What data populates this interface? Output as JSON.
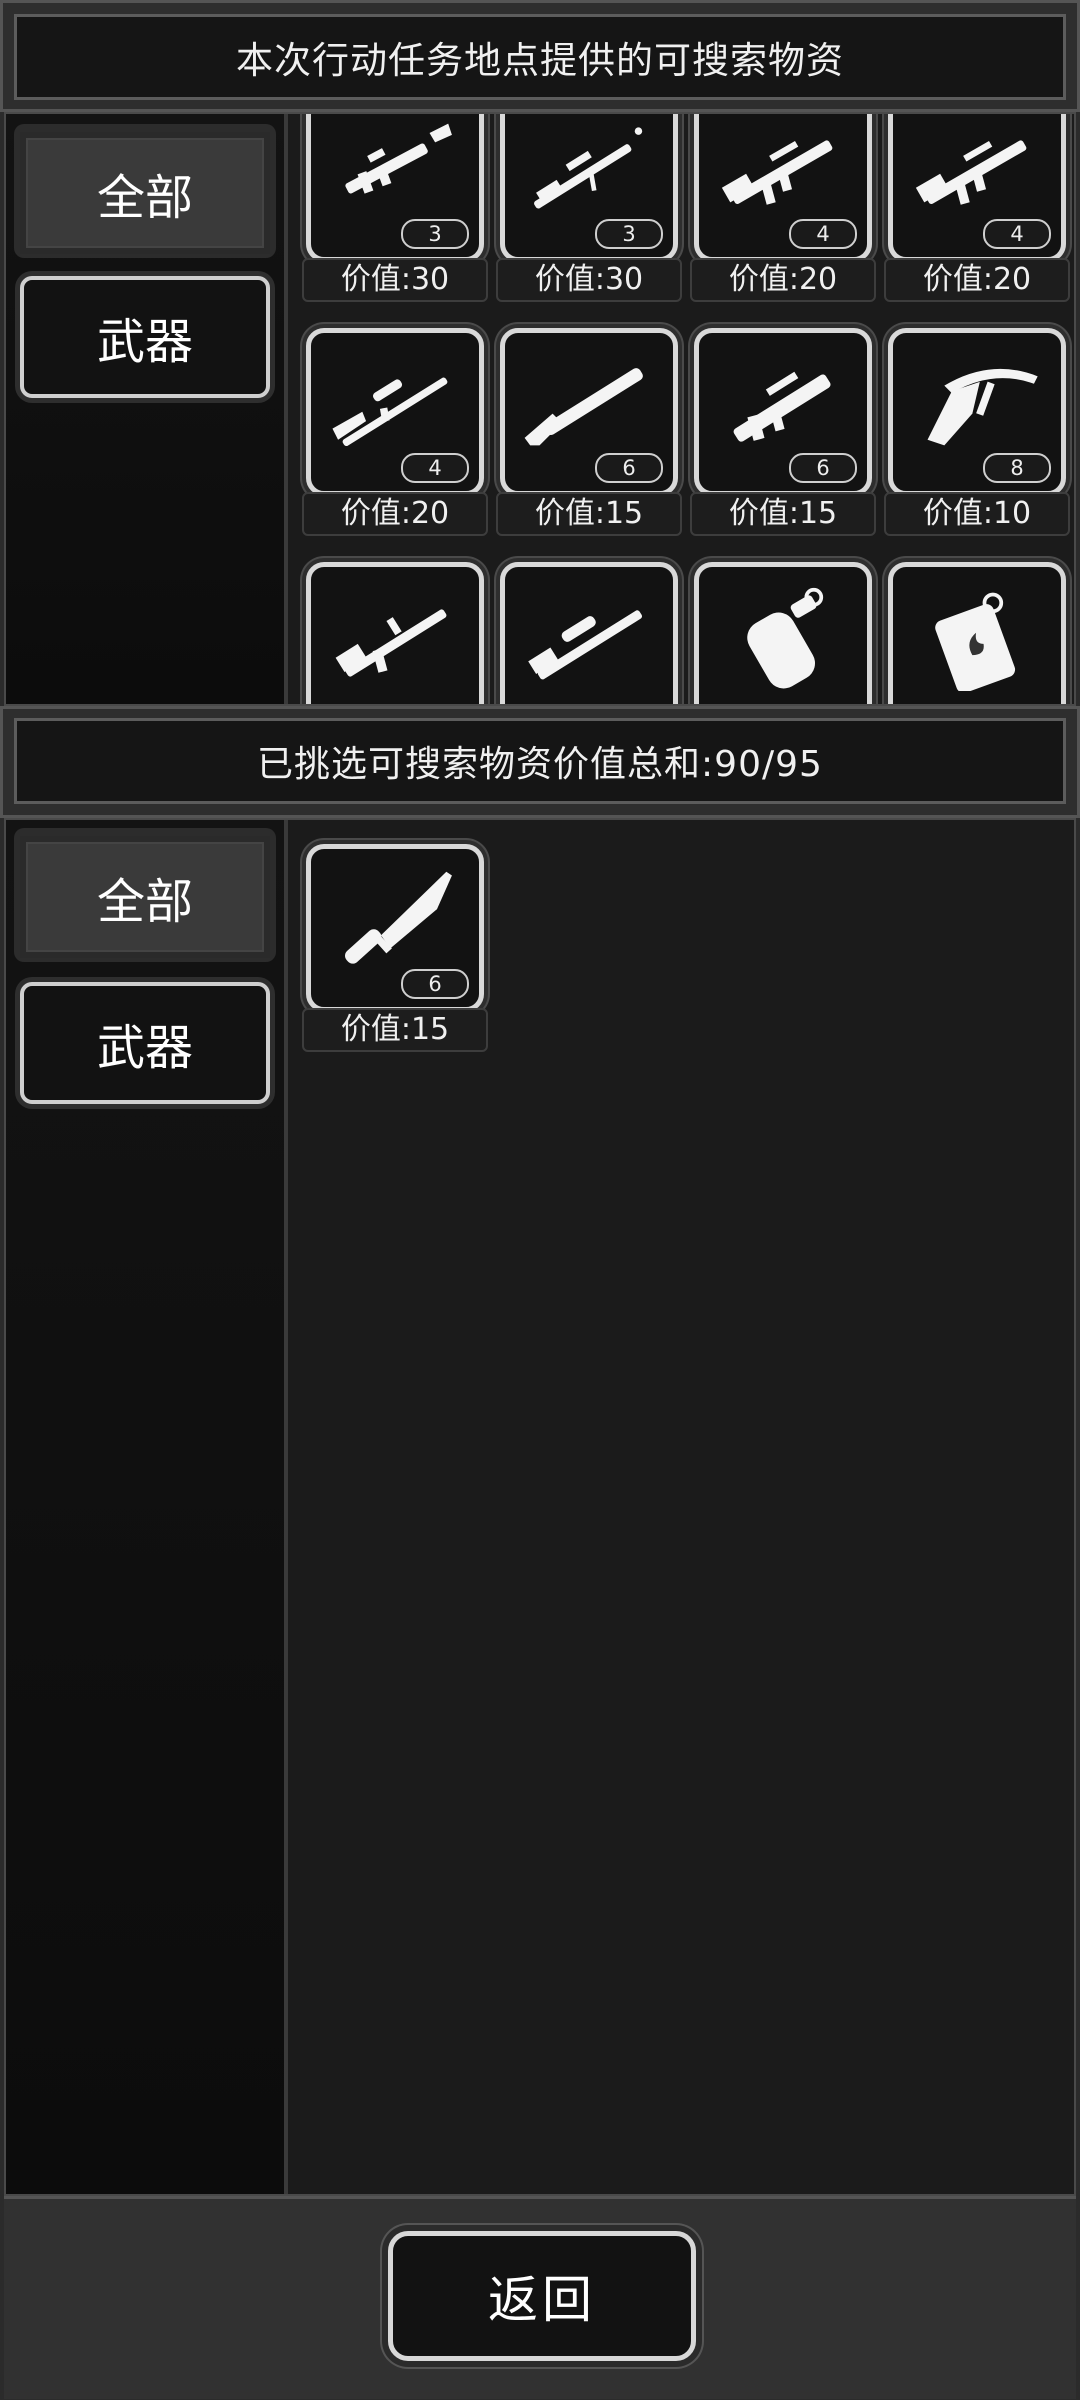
{
  "top_title": "本次行动任务地点提供的可搜索物资",
  "selected_title": "已挑选可搜索物资价值总和:90/95",
  "tabs": [
    {
      "label": "全部"
    },
    {
      "label": "武器"
    }
  ],
  "available_items": [
    {
      "icon": "rocket-launcher-icon",
      "count": "3",
      "value": "价值:30"
    },
    {
      "icon": "sniper-rifle-icon",
      "count": "3",
      "value": "价值:30"
    },
    {
      "icon": "assault-rifle-icon",
      "count": "4",
      "value": "价值:20"
    },
    {
      "icon": "assault-rifle-icon",
      "count": "4",
      "value": "价值:20"
    },
    {
      "icon": "hunting-rifle-icon",
      "count": "4",
      "value": "价值:20"
    },
    {
      "icon": "shotgun-icon",
      "count": "6",
      "value": "价值:15"
    },
    {
      "icon": "bullpup-rifle-icon",
      "count": "6",
      "value": "价值:15"
    },
    {
      "icon": "crossbow-icon",
      "count": "8",
      "value": "价值:10"
    },
    {
      "icon": "m16-rifle-icon",
      "count": "",
      "value": ""
    },
    {
      "icon": "scoped-rifle-icon",
      "count": "",
      "value": ""
    },
    {
      "icon": "grenade-icon",
      "count": "",
      "value": ""
    },
    {
      "icon": "fire-canister-icon",
      "count": "",
      "value": ""
    }
  ],
  "selected_items": [
    {
      "icon": "knife-icon",
      "count": "6",
      "value": "价值:15"
    }
  ],
  "back_label": "返回"
}
